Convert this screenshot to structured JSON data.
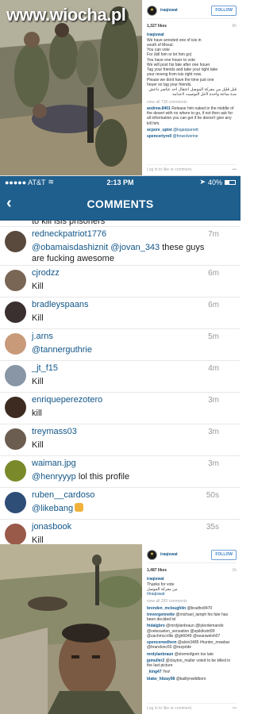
{
  "watermark": "www.wiocha.pl",
  "top_post": {
    "username": "iraqiswat",
    "follow": "FOLLOW",
    "likes": "1,327 likes",
    "age": "6h",
    "caption_lines": [
      "We have arrested one of isis in",
      "south of Mosul.",
      "You can vote",
      "For (kill him or let him go)",
      "You have one houer to vote",
      "We will post his fate after one houer",
      "Tag your friends and take your right take",
      "your reveng from isis right now.",
      "Please we dont have the time just one",
      "houer so tag your friends.",
      "قبل قليل من معركة الموصل اعتقال احد عناصر داعش",
      "مدة ساعة واحدة لأجل التوصيت لاعدامه"
    ],
    "view_all": "view all 738 comments",
    "comments": [
      {
        "user": "andrew.8401",
        "text": "Release him naked in the middle of the desert with no where to go, if not then ask for all information you can get if he doesn't give any kill him."
      },
      {
        "user": "ocpore_uptst",
        "text": "@loganparrett"
      },
      {
        "user": "spencertyrell",
        "text": "@frowolverine"
      }
    ],
    "login": "Log in to like or comment."
  },
  "phone": {
    "carrier": "●●●●● AT&T",
    "time": "2:13 PM",
    "battery": "40%",
    "battery_level": 0.4,
    "title": "COMMENTS",
    "cutoff_text": "to kill isis prisoners",
    "comments": [
      {
        "user": "redneckpatriot1776",
        "age": "7m",
        "text": "@obamaisdashiznit @jovan_343 these guys are fucking awesome"
      },
      {
        "user": "cjrodzz",
        "age": "6m",
        "text": "Kill"
      },
      {
        "user": "bradleyspaans",
        "age": "6m",
        "text": "Kill"
      },
      {
        "user": "j.arns",
        "age": "5m",
        "text": "@tannerguthrie"
      },
      {
        "user": "_jt_f15",
        "age": "4m",
        "text": "Kill"
      },
      {
        "user": "enriqueperezotero",
        "age": "3m",
        "text": "kill"
      },
      {
        "user": "treymass03",
        "age": "3m",
        "text": "Kill"
      },
      {
        "user": "waiman.jpg",
        "age": "3m",
        "text": "@henryyyp lol this profile"
      },
      {
        "user": "ruben__cardoso",
        "age": "50s",
        "text": "@likebang"
      },
      {
        "user": "jonasbook",
        "age": "35s",
        "text": "Kill"
      }
    ]
  },
  "bottom_post": {
    "username": "iraqiswat",
    "follow": "FOLLOW",
    "likes": "1,487 likes",
    "age": "1h",
    "caption_lines": [
      "Thanks for vote",
      "من معركة الموصل",
      "#iraqiswat"
    ],
    "view_all": "view all 283 comments",
    "comments": [
      {
        "user": "brenden_mcloughlin",
        "text": "@bradho8470"
      },
      {
        "user": "trevorgennette",
        "text": "@michael_lamph his fate has been decided lol"
      },
      {
        "user": "hidalgbro",
        "text": "@mrdylanbraun @tylerdemando @velezuelen_sensation @epiktkotrt99 @zachmccrillis @gh6049 @seanwelsh07"
      },
      {
        "user": "spencerwelhem",
        "text": "@alvin3485 #hunter_mowbar @brandonc60 @rezpride"
      },
      {
        "user": "mrdylanbraun",
        "text": "@stormofgom too late"
      },
      {
        "user": "jpmuller2",
        "text": "@clayton_muller voted to be killed in the last picture"
      },
      {
        "user": "_king47",
        "text": "Yes!"
      },
      {
        "user": "blake_hitzay98",
        "text": "@kaitlynwildborn"
      }
    ],
    "login": "Log in to like or comment."
  }
}
